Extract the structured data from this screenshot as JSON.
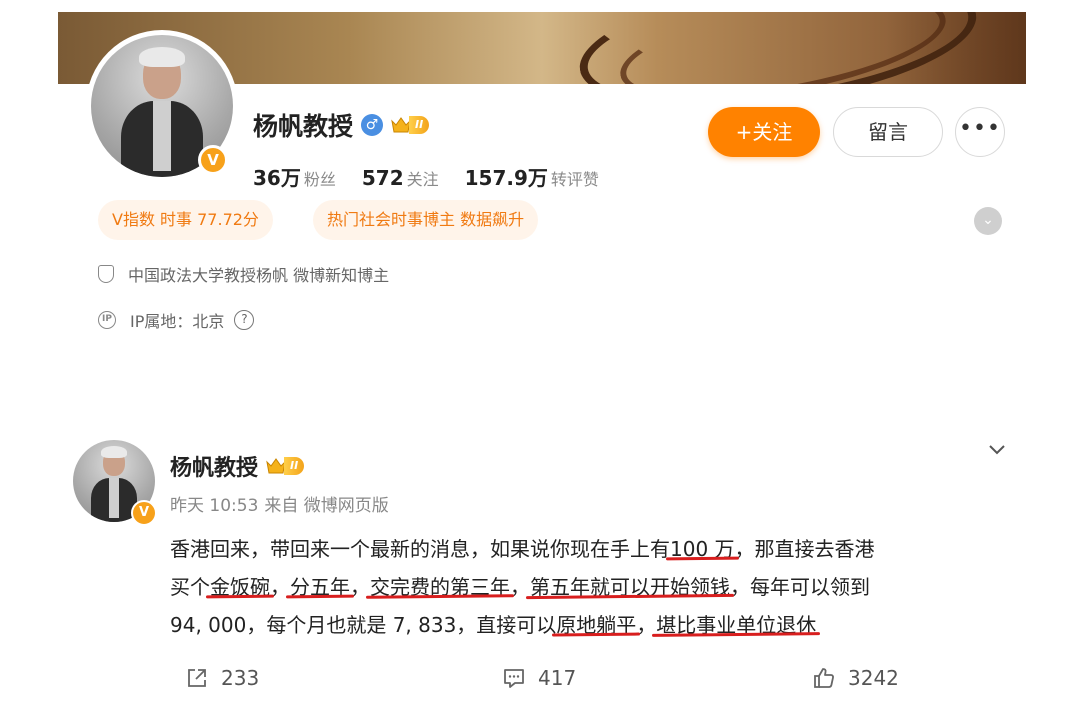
{
  "profile": {
    "name": "杨帆教授",
    "level": "II",
    "stats": [
      {
        "num": "36万",
        "label": "粉丝"
      },
      {
        "num": "572",
        "label": "关注"
      },
      {
        "num": "157.9万",
        "label": "转评赞"
      }
    ],
    "follow_label": "+关注",
    "message_label": "留言",
    "more_label": "•••",
    "tags": [
      "V指数 时事 77.72分",
      "热门社会时事博主 数据飙升"
    ],
    "verification": "中国政法大学教授杨帆 微博新知博主",
    "ip_location": "IP属地：北京",
    "ip_icon_text": "IP",
    "badge_letter": "V",
    "colors": {
      "accent": "#ff8200",
      "tag_text": "#f07a12",
      "tag_bg": "#fff4ea",
      "vip_badge": "#f7a11a"
    }
  },
  "post": {
    "author": "杨帆教授",
    "level": "II",
    "time": "昨天 10:53",
    "source": "来自 微博网页版",
    "badge_letter": "V",
    "line1_a": "香港回来，带回来一个最新的消息，如果说你现在手上有",
    "line1_u1": "100 万",
    "line1_b": "，那直接去香港",
    "line2_a": "买个",
    "line2_u1": "金饭碗",
    "line2_b": "，",
    "line2_u2": "分五年",
    "line2_c": "，",
    "line2_u3": "交完费的第三年",
    "line2_d": "，",
    "line2_u4": "第五年就可以开始领钱",
    "line2_e": "，每年可以领到",
    "line3_a": "94, 000，每个月也就是 7, 833，直接可以",
    "line3_u1": "原地躺平",
    "line3_b": "，",
    "line3_u2": "堪比事业单位退休",
    "shares": "233",
    "comments": "417",
    "likes": "3242",
    "underline_color": "#d81e1e"
  }
}
